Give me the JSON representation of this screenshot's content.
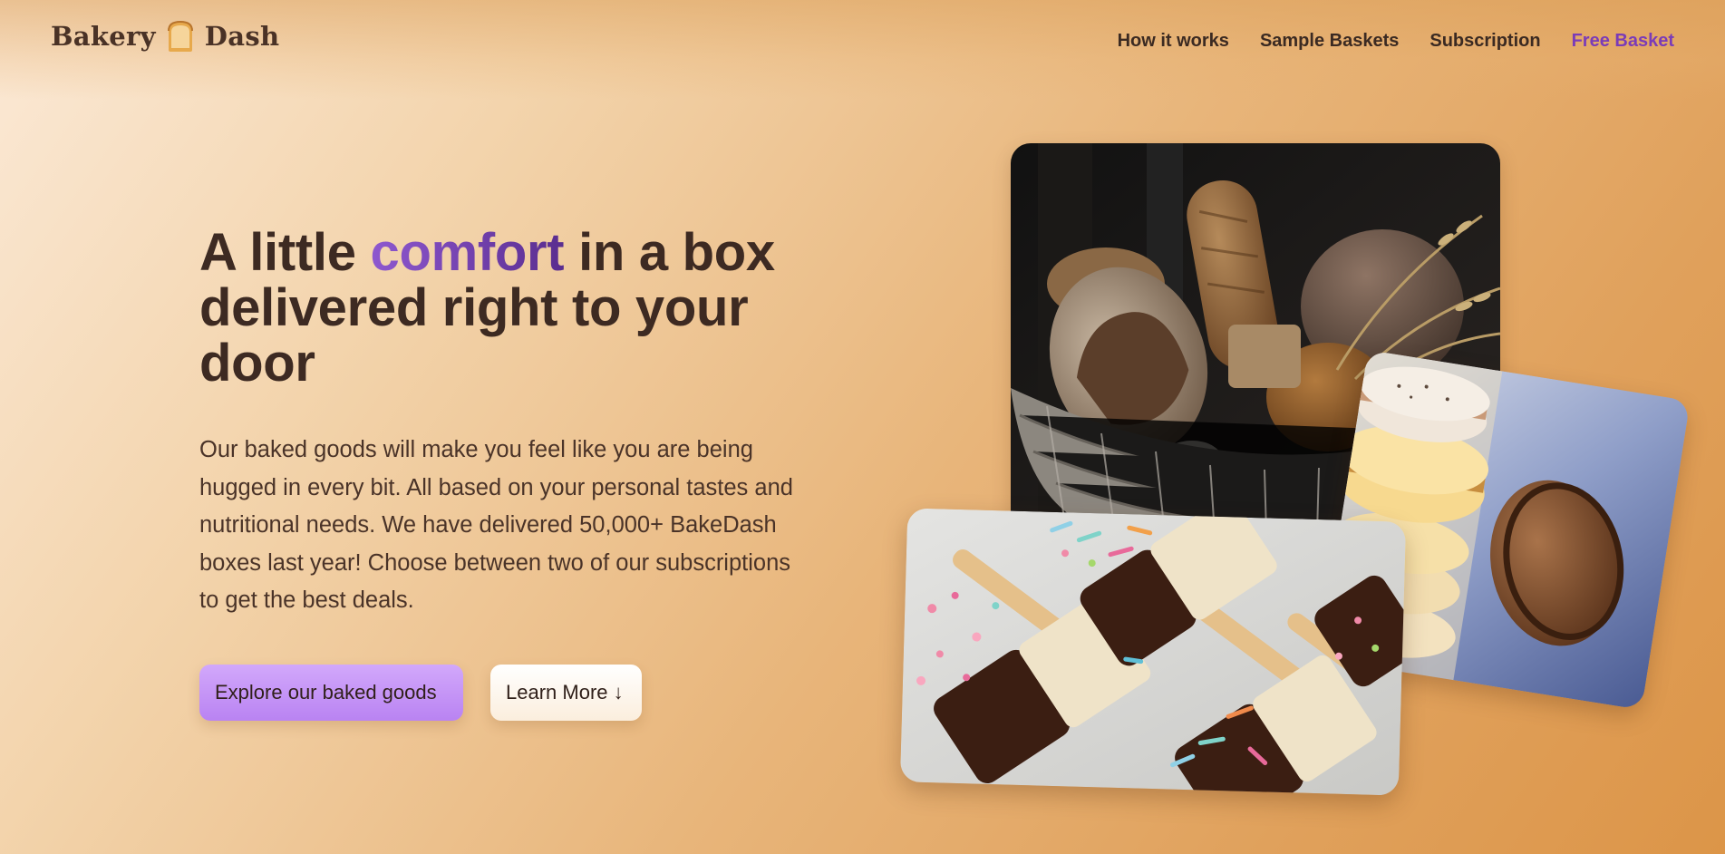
{
  "brand": {
    "name_part1": "Bakery",
    "name_part2": "Dash",
    "icon": "bread-toast-icon"
  },
  "nav": {
    "items": [
      {
        "label": "How it works"
      },
      {
        "label": "Sample Baskets"
      },
      {
        "label": "Subscription"
      },
      {
        "label": "Free Basket"
      }
    ]
  },
  "hero": {
    "title_before": "A little ",
    "title_highlight": "comfort",
    "title_after": " in a box delivered right to your door",
    "description": "Our baked goods will make you feel like you are being hugged in every bit. All based on your personal tastes and nutritional needs. We have delivered 50,000+ BakeDash boxes last year! Choose between two of our subscriptions to get the best deals.",
    "primary_button": "Explore our baked goods",
    "secondary_button": "Learn More ↓"
  },
  "images": {
    "bread": "bread-basket-photo",
    "macaron": "macaron-stack-photo",
    "treats": "chocolate-rice-treats-photo"
  },
  "colors": {
    "accent": "#7a3bb8",
    "text": "#3d2a22",
    "primary_button": "#c696f7"
  }
}
